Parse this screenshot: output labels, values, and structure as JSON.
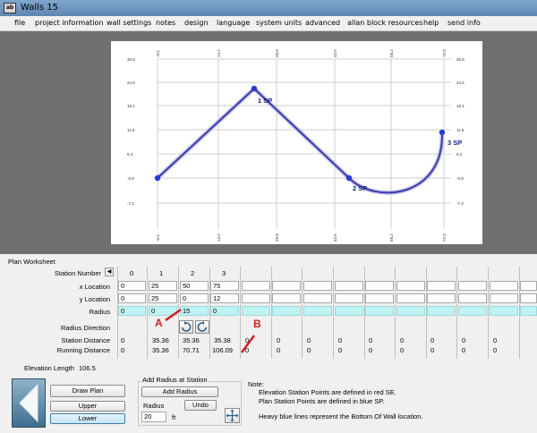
{
  "window": {
    "title": "Walls 15",
    "icon_label": "ab"
  },
  "menu": [
    "file",
    "project information",
    "wall settings",
    "notes",
    "design",
    "language",
    "system units",
    "advanced",
    "allan block resources",
    "help",
    "send info"
  ],
  "plot": {
    "left_ticks": [
      "30.6",
      "24.5",
      "18.1",
      "11.8",
      "5.4",
      "-0.9",
      "-7.3"
    ],
    "right_ticks": [
      "30.6",
      "24.5",
      "18.1",
      "11.8",
      "5.4",
      "-0.9",
      "-7.3"
    ],
    "top_ticks": [
      "-0.5",
      "14.2",
      "28.8",
      "43.5",
      "58.2",
      "72.9"
    ],
    "bottom_ticks": [
      "-0.5",
      "14.2",
      "28.8",
      "43.5",
      "58.2",
      "72.9"
    ],
    "point_labels": [
      "1 SP",
      "2 SP",
      "3 SP"
    ],
    "line_color": "#3a3ab0",
    "point_color": "#2a3ad8",
    "label_color": "#1a237e"
  },
  "worksheet": {
    "title": "Plan Worksheet",
    "station_number_label": "Station Number",
    "row_labels": {
      "x": "x Location",
      "y": "y Location",
      "radius": "Radius",
      "direction": "Radius Direction",
      "station_distance": "Station Distance",
      "running_distance": "Running Distance"
    },
    "stations": [
      "0",
      "1",
      "2",
      "3"
    ],
    "x_values": [
      "0",
      "25",
      "50",
      "75"
    ],
    "y_values": [
      "0",
      "25",
      "0",
      "12"
    ],
    "radius_values": [
      "0",
      "0",
      "15",
      "0"
    ],
    "station_distance": [
      "0",
      "35.36",
      "35.36",
      "35.38",
      "0",
      "0",
      "0",
      "0",
      "0",
      "0",
      "0",
      "0",
      "0"
    ],
    "running_distance": [
      "0",
      "35.36",
      "70.71",
      "106.09",
      "0",
      "0",
      "0",
      "0",
      "0",
      "0",
      "0",
      "0",
      "0"
    ],
    "elevation_length_label": "Elevation Length",
    "elevation_length_value": "106.5"
  },
  "annotations": {
    "a": "A",
    "b": "B",
    "color": "#d11f26"
  },
  "controls": {
    "draw_plan": "Draw Plan",
    "upper": "Upper",
    "lower": "Lower",
    "add_radius_group": "Add Radius at Station",
    "add_radius": "Add Radius",
    "radius_label": "Radius",
    "radius_value": "20",
    "radius_unit": "ft",
    "undo": "Undo"
  },
  "note": {
    "title": "Note:",
    "line1": "Elevation Station Points are defined in red SE.",
    "line2": "Plan Station Points are defined in blue SP.",
    "line3": "Heavy blue lines represent the Bottom Of Wall location."
  }
}
